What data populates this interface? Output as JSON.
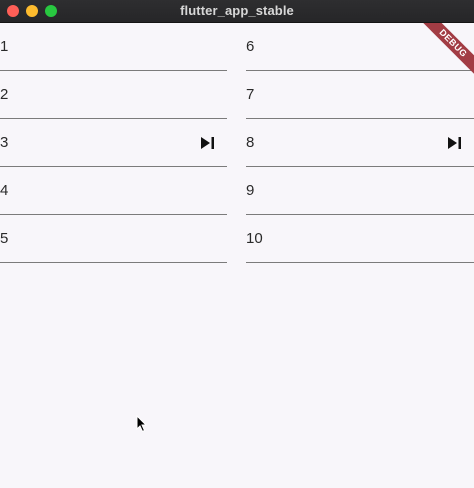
{
  "window": {
    "title": "flutter_app_stable"
  },
  "debug_banner": {
    "label": "DEBUG",
    "color": "#a23c44"
  },
  "list": {
    "left": [
      {
        "label": "1",
        "icon": null
      },
      {
        "label": "2",
        "icon": null
      },
      {
        "label": "3",
        "icon": "skip-next-icon"
      },
      {
        "label": "4",
        "icon": null
      },
      {
        "label": "5",
        "icon": null
      }
    ],
    "right": [
      {
        "label": "6",
        "icon": null
      },
      {
        "label": "7",
        "icon": null
      },
      {
        "label": "8",
        "icon": "skip-next-icon"
      },
      {
        "label": "9",
        "icon": null
      },
      {
        "label": "10",
        "icon": null
      }
    ]
  },
  "colors": {
    "background": "#f8f6fa",
    "divider": "#7b7b7b",
    "text": "#2a2a2a"
  }
}
